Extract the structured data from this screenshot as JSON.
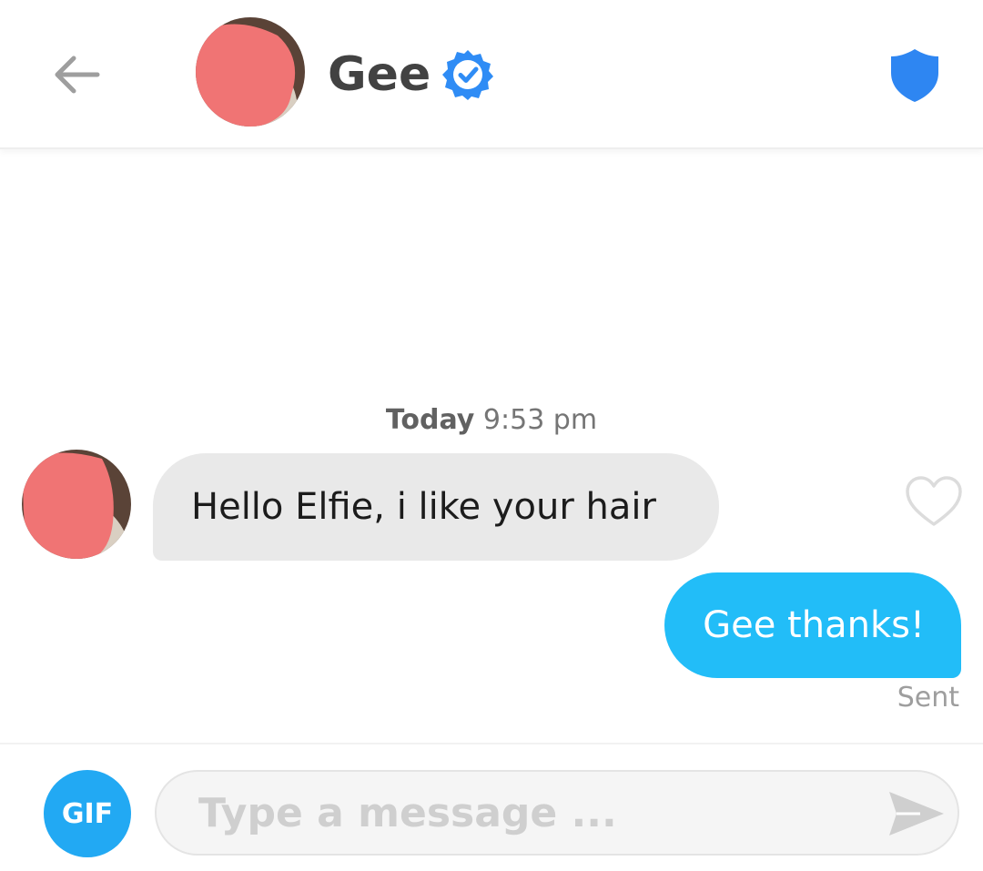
{
  "header": {
    "contact_name": "Gee",
    "verified": true,
    "colors": {
      "verified_badge": "#2f8cf5",
      "shield": "#2e86f2",
      "back_arrow": "#9e9e9e"
    }
  },
  "conversation": {
    "timestamp": {
      "day": "Today",
      "time": "9:53 pm"
    },
    "messages": [
      {
        "direction": "incoming",
        "text": "Hello Elfie, i like your hair",
        "liked": false
      },
      {
        "direction": "outgoing",
        "text": "Gee thanks!",
        "status": "Sent"
      }
    ],
    "colors": {
      "incoming_bubble": "#e9e9e9",
      "outgoing_bubble": "#22bdf8"
    }
  },
  "composer": {
    "gif_label": "GIF",
    "input_value": "",
    "input_placeholder": "Type a message ...",
    "colors": {
      "gif_button": "#22a9f3",
      "send_icon": "#cfcfcf"
    }
  },
  "icons": {
    "back": "arrow-left-icon",
    "verified": "verified-badge-icon",
    "safety": "shield-icon",
    "like": "heart-outline-icon",
    "send": "send-icon"
  }
}
